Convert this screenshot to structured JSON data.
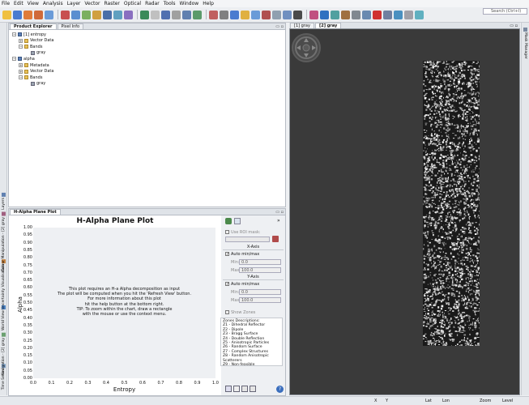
{
  "menubar": [
    "File",
    "Edit",
    "View",
    "Analysis",
    "Layer",
    "Vector",
    "Raster",
    "Optical",
    "Radar",
    "Tools",
    "Window",
    "Help"
  ],
  "search": {
    "placeholder": "Search (Ctrl+I)"
  },
  "left_tabs": [
    "Time Series",
    "Navigation - [2] gray",
    "World View",
    "Uncertainty Visualisation",
    "Colour Manipulation - [2] gray",
    "Layers"
  ],
  "right_tabs": [
    "Mask Manager"
  ],
  "product_explorer": {
    "tabs": [
      "Product Explorer",
      "Pixel Info"
    ],
    "tree": [
      {
        "label": "[1] entropy",
        "level": 0,
        "kind": "product",
        "exp": "−"
      },
      {
        "label": "Vector Data",
        "level": 1,
        "kind": "folder",
        "exp": "+"
      },
      {
        "label": "Bands",
        "level": 1,
        "kind": "folder",
        "exp": "−"
      },
      {
        "label": "gray",
        "level": 2,
        "kind": "band",
        "exp": ""
      },
      {
        "label": "alpha",
        "level": 0,
        "kind": "product",
        "exp": "−"
      },
      {
        "label": "Metadata",
        "level": 1,
        "kind": "folder",
        "exp": "+"
      },
      {
        "label": "Vector Data",
        "level": 1,
        "kind": "folder",
        "exp": "+"
      },
      {
        "label": "Bands",
        "level": 1,
        "kind": "folder",
        "exp": "−"
      },
      {
        "label": "gray",
        "level": 2,
        "kind": "band",
        "exp": ""
      }
    ]
  },
  "halpha": {
    "tab": "H-Alpha Plane Plot",
    "title": "H-Alpha Plane Plot",
    "xlabel": "Entropy",
    "ylabel": "Alpha",
    "message": [
      "This plot requires an H-a Alpha decomposition as input",
      "The plot will be computed when you hit the 'Refresh View' button.",
      "For more information about this plot",
      "hit the help button at the bottom right.",
      "TIP: To zoom within the chart, draw a rectangle",
      "with the mouse or use the context menu."
    ],
    "yticks": [
      "1.00",
      "0.95",
      "0.90",
      "0.85",
      "0.80",
      "0.75",
      "0.70",
      "0.65",
      "0.60",
      "0.55",
      "0.50",
      "0.45",
      "0.40",
      "0.35",
      "0.30",
      "0.25",
      "0.20",
      "0.15",
      "0.10",
      "0.05",
      "0.00"
    ],
    "xticks": [
      "0.0",
      "0.1",
      "0.2",
      "0.3",
      "0.4",
      "0.5",
      "0.6",
      "0.7",
      "0.8",
      "0.9",
      "1.0"
    ]
  },
  "side": {
    "use_roi": "Use ROI mask:",
    "xaxis": "X-Axis",
    "auto_x": "Auto min/max",
    "min_label": "Min:",
    "max_label": "Max:",
    "x_min": "0.0",
    "x_max": "100.0",
    "yaxis": "Y-Axis",
    "auto_y": "Auto min/max",
    "y_min": "0.0",
    "y_max": "100.0",
    "show_zones": "Show Zones",
    "zones_title": "Zones Descriptions:",
    "zones": [
      "Z1 - Dihedral Reflector",
      "Z2 - Dipole",
      "Z3 - Bragg Surface",
      "Z4 - Double Reflection",
      "Z5 - Anisotropic Particles",
      "Z6 - Random Surface",
      "Z7 - Complex Structures",
      "Z8 - Random Anisotropic Scatterers",
      "Z9 - Non-feasible"
    ]
  },
  "image_view": {
    "tabs": [
      "[1] gray",
      "[2] gray"
    ]
  },
  "status": {
    "x": "X",
    "y": "Y",
    "lat": "Lat",
    "lon": "Lon",
    "zoom": "Zoom",
    "level": "Level"
  }
}
